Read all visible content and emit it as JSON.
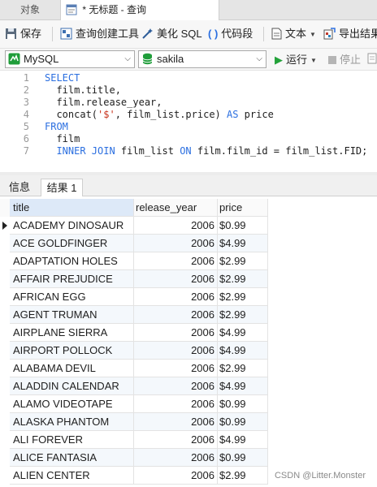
{
  "tabs": [
    {
      "label": "对象",
      "active": false
    },
    {
      "label": "* 无标题 - 查询",
      "active": true
    }
  ],
  "toolbar": {
    "save": "保存",
    "query_builder": "查询创建工具",
    "beautify": "美化 SQL",
    "code_snippet": "代码段",
    "text": "文本",
    "export": "导出结果"
  },
  "connection": {
    "type": "MySQL",
    "database": "sakila",
    "run": "运行",
    "stop": "停止"
  },
  "editor": {
    "line_numbers": [
      "1",
      "2",
      "3",
      "4",
      "5",
      "6",
      "7"
    ]
  },
  "result_tabs": {
    "info": "信息",
    "result": "结果 1"
  },
  "grid": {
    "columns": [
      "title",
      "release_year",
      "price"
    ],
    "rows": [
      [
        "ACADEMY DINOSAUR",
        "2006",
        "$0.99"
      ],
      [
        "ACE GOLDFINGER",
        "2006",
        "$4.99"
      ],
      [
        "ADAPTATION HOLES",
        "2006",
        "$2.99"
      ],
      [
        "AFFAIR PREJUDICE",
        "2006",
        "$2.99"
      ],
      [
        "AFRICAN EGG",
        "2006",
        "$2.99"
      ],
      [
        "AGENT TRUMAN",
        "2006",
        "$2.99"
      ],
      [
        "AIRPLANE SIERRA",
        "2006",
        "$4.99"
      ],
      [
        "AIRPORT POLLOCK",
        "2006",
        "$4.99"
      ],
      [
        "ALABAMA DEVIL",
        "2006",
        "$2.99"
      ],
      [
        "ALADDIN CALENDAR",
        "2006",
        "$4.99"
      ],
      [
        "ALAMO VIDEOTAPE",
        "2006",
        "$0.99"
      ],
      [
        "ALASKA PHANTOM",
        "2006",
        "$0.99"
      ],
      [
        "ALI FOREVER",
        "2006",
        "$4.99"
      ],
      [
        "ALICE FANTASIA",
        "2006",
        "$0.99"
      ],
      [
        "ALIEN CENTER",
        "2006",
        "$2.99"
      ]
    ]
  },
  "watermark": "CSDN @Litter.Monster"
}
